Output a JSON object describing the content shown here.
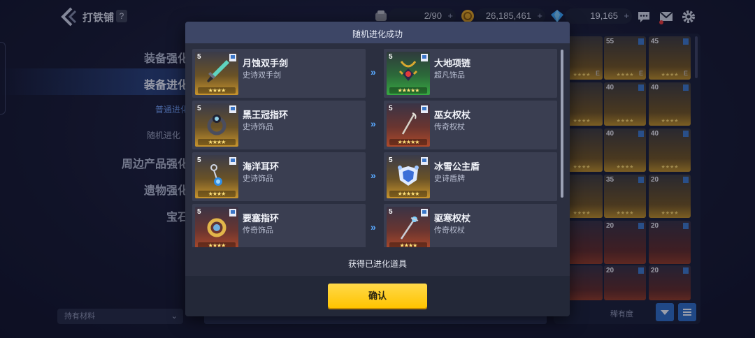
{
  "shop": {
    "title": "打铁铺",
    "help": "?"
  },
  "resources": [
    {
      "name": "stamina",
      "value": "2/90"
    },
    {
      "name": "gold",
      "value": "26,185,461"
    },
    {
      "name": "gems",
      "value": "19,165"
    }
  ],
  "sidebar": {
    "items": [
      "装备强化",
      "装备进化",
      "普通进化",
      "随机进化",
      "周边产品强化",
      "遗物强化",
      "宝石"
    ],
    "materials_filter": "持有材料"
  },
  "inventory": {
    "levels": [
      "55",
      "45",
      "40",
      "40",
      "40",
      "40",
      "35",
      "20",
      "20",
      "20",
      "20",
      "20"
    ],
    "grade_mark": "E",
    "stars": "★★★★",
    "sort_label": "稀有度"
  },
  "modal": {
    "title": "随机进化成功",
    "rows": [
      {
        "from": {
          "level": "5",
          "name": "月蚀双手剑",
          "type": "史诗双手剑",
          "stars": "★★★★"
        },
        "to": {
          "level": "5",
          "name": "大地项链",
          "type": "超凡饰品",
          "stars": "★★★★★"
        }
      },
      {
        "from": {
          "level": "5",
          "name": "黑王冠指环",
          "type": "史诗饰品",
          "stars": "★★★★"
        },
        "to": {
          "level": "5",
          "name": "巫女权杖",
          "type": "传奇权杖",
          "stars": "★★★★★"
        }
      },
      {
        "from": {
          "level": "5",
          "name": "海洋耳环",
          "type": "史诗饰品",
          "stars": "★★★★"
        },
        "to": {
          "level": "5",
          "name": "冰雪公主盾",
          "type": "史诗盾牌",
          "stars": "★★★★★"
        }
      },
      {
        "from": {
          "level": "5",
          "name": "要塞指环",
          "type": "传奇饰品",
          "stars": "★★★★"
        },
        "to": {
          "level": "5",
          "name": "驱寒权杖",
          "type": "传奇权杖",
          "stars": "★★★★"
        }
      }
    ],
    "arrow": "»",
    "footer": "获得已进化道具",
    "confirm_label": "确认"
  }
}
